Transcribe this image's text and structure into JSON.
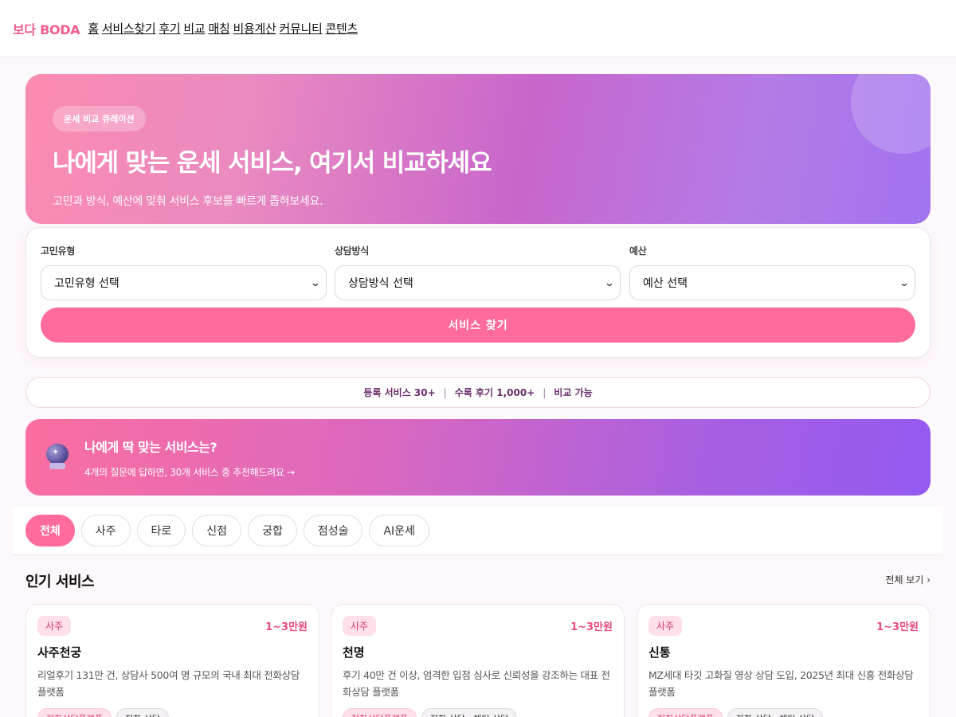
{
  "nav": {
    "logo": "보다 BODA",
    "links": [
      "홈",
      "서비스찾기",
      "후기",
      "비교",
      "매칭",
      "비용계산",
      "커뮤니티",
      "콘텐츠"
    ]
  },
  "hero": {
    "pill": "운세 비교 큐레이션",
    "title": "나에게 맞는 운세 서비스, 여기서 비교하세요",
    "subtitle": "고민과 방식, 예산에 맞춰 서비스 후보를 빠르게 좁혀보세요."
  },
  "filters": {
    "worry": {
      "label": "고민유형",
      "value": "고민유형 선택"
    },
    "method": {
      "label": "상담방식",
      "value": "상담방식 선택"
    },
    "budget": {
      "label": "예산",
      "value": "예산 선택"
    },
    "submit_label": "서비스 찾기"
  },
  "stats": {
    "items": [
      "등록 서비스 30+",
      "수록 후기 1,000+",
      "비교 가능"
    ],
    "separator": "|"
  },
  "promo": {
    "icon": "crystal-ball-icon",
    "title": "나에게 딱 맞는 서비스는?",
    "subtitle": "4개의 질문에 답하면, 30개 서비스 중 추천해드려요 →"
  },
  "tabs": {
    "items": [
      "전체",
      "사주",
      "타로",
      "신점",
      "궁합",
      "점성술",
      "AI운세"
    ],
    "active": "전체"
  },
  "popular": {
    "title": "인기 서비스",
    "see_all": "전체 보기 ›",
    "cards": [
      {
        "category": "사주",
        "price": "1~3만원",
        "name": "사주천궁",
        "description": "리얼후기 131만 건, 상담사 500여 명 규모의 국내 최대 전화상담 플랫폼",
        "tags": [
          "전화상담플랫폼",
          "전화 상담"
        ]
      },
      {
        "category": "사주",
        "price": "1~3만원",
        "name": "천명",
        "description": "후기 40만 건 이상, 엄격한 입점 심사로 신뢰성을 강조하는 대표 전화상담 플랫폼",
        "tags": [
          "전화상담플랫폼",
          "전화 상담 · 채팅 상담"
        ]
      },
      {
        "category": "사주",
        "price": "1~3만원",
        "name": "신통",
        "description": "MZ세대 타깃 고화질 영상 상담 도입, 2025년 최대 신흥 전화상담 플랫폼",
        "tags": [
          "전화상담플랫폼",
          "전화 상담 · 채팅 상담"
        ]
      }
    ]
  },
  "colors": {
    "accent": "#ff6b9c",
    "brand": "#f25c8f",
    "price": "#e84a82"
  }
}
